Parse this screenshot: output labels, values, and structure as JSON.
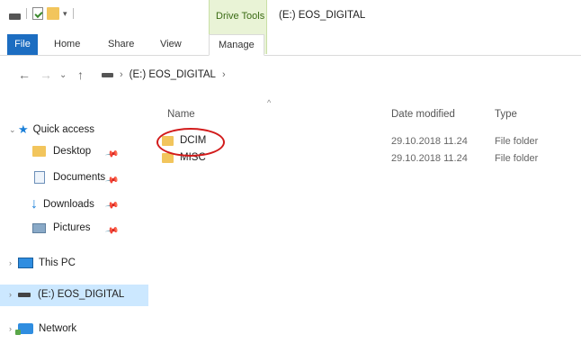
{
  "titlebar": {
    "context_tab": "Drive Tools",
    "window_title": "(E:) EOS_DIGITAL"
  },
  "ribbon": {
    "tabs": [
      "File",
      "Home",
      "Share",
      "View",
      "Manage"
    ]
  },
  "address": {
    "back_icon": "back-arrow-icon",
    "path": "(E:) EOS_DIGITAL"
  },
  "nav": {
    "quick_access": "Quick access",
    "desktop": "Desktop",
    "documents": "Documents",
    "downloads": "Downloads",
    "pictures": "Pictures",
    "this_pc": "This PC",
    "drive": "(E:) EOS_DIGITAL",
    "network": "Network"
  },
  "columns": {
    "name": "Name",
    "date": "Date modified",
    "type": "Type"
  },
  "files": [
    {
      "name": "DCIM",
      "date": "29.10.2018 11.24",
      "type": "File folder"
    },
    {
      "name": "MISC",
      "date": "29.10.2018 11.24",
      "type": "File folder"
    }
  ],
  "colors": {
    "file_tab": "#1c6dc1",
    "context_tab": "#e9f3d6",
    "selection": "#cce8ff",
    "highlight_circle": "#d21b1b"
  }
}
